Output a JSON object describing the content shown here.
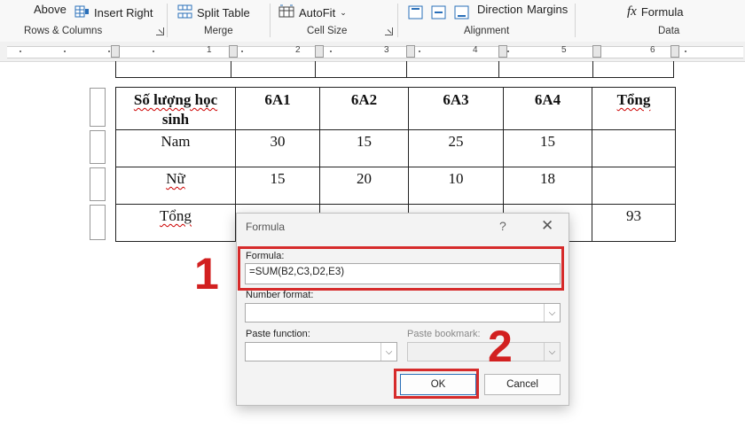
{
  "ribbon": {
    "above_label": "Above",
    "insert_right_label": "Insert Right",
    "split_table_label": "Split Table",
    "autofit_label": "AutoFit",
    "direction_label": "Direction",
    "margins_label": "Margins",
    "formula_label": "Formula",
    "groups": {
      "rows_columns": "Rows & Columns",
      "merge": "Merge",
      "cell_size": "Cell Size",
      "alignment": "Alignment",
      "data": "Data"
    }
  },
  "ruler": {
    "numbers": [
      "1",
      "2",
      "3",
      "4",
      "5",
      "6"
    ]
  },
  "table": {
    "header": {
      "label_line1": "Số lượng học",
      "label_line2": "sinh",
      "cols": [
        "6A1",
        "6A2",
        "6A3",
        "6A4"
      ],
      "total": "Tổng"
    },
    "rows": [
      {
        "label": "Nam",
        "values": [
          "30",
          "15",
          "25",
          "15"
        ],
        "total": ""
      },
      {
        "label": "Nữ",
        "values": [
          "15",
          "20",
          "10",
          "18"
        ],
        "total": ""
      },
      {
        "label": "Tổng",
        "values": [
          "",
          "",
          "",
          ""
        ],
        "total": "93"
      }
    ]
  },
  "dialog": {
    "title": "Formula",
    "help": "?",
    "close": "✕",
    "formula_label": "Formula:",
    "formula_value": "=SUM(B2,C3,D2,E3)",
    "number_format_label": "Number format:",
    "number_format_value": "",
    "paste_function_label": "Paste function:",
    "paste_bookmark_label": "Paste bookmark:",
    "ok_label": "OK",
    "cancel_label": "Cancel"
  },
  "annotations": {
    "step1": "1",
    "step2": "2"
  },
  "colors": {
    "highlight": "#d62b2b",
    "annotation": "#d22020"
  }
}
